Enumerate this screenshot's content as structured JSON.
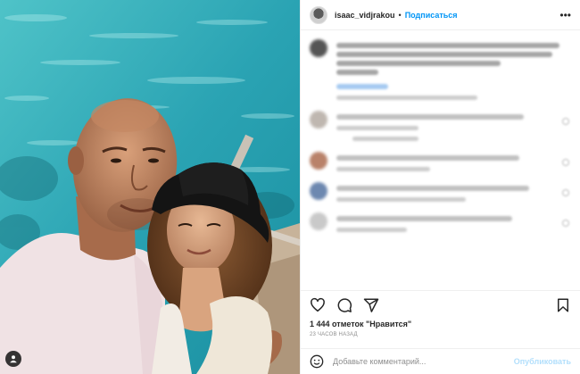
{
  "post": {
    "username": "isaac_vidjrakou",
    "separator": "•",
    "follow_label": "Подписаться",
    "more_icon": "more-horizontal-icon",
    "more_glyph": "•••"
  },
  "actions": {
    "like_icon": "heart-icon",
    "comment_icon": "comment-icon",
    "share_icon": "send-icon",
    "save_icon": "bookmark-icon"
  },
  "stats": {
    "likes_text": "1 444 отметок \"Нравится\"",
    "time_ago": "23 ЧАСОВ НАЗАД"
  },
  "compose": {
    "emoji_icon": "emoji-smile-icon",
    "placeholder": "Добавьте комментарий...",
    "publish_label": "Опубликовать"
  },
  "photo": {
    "profile_icon": "user-tag-icon"
  },
  "colors": {
    "accent": "#0095f6",
    "publish_disabled": "#b2dffc",
    "muted": "#8e8e8e"
  }
}
